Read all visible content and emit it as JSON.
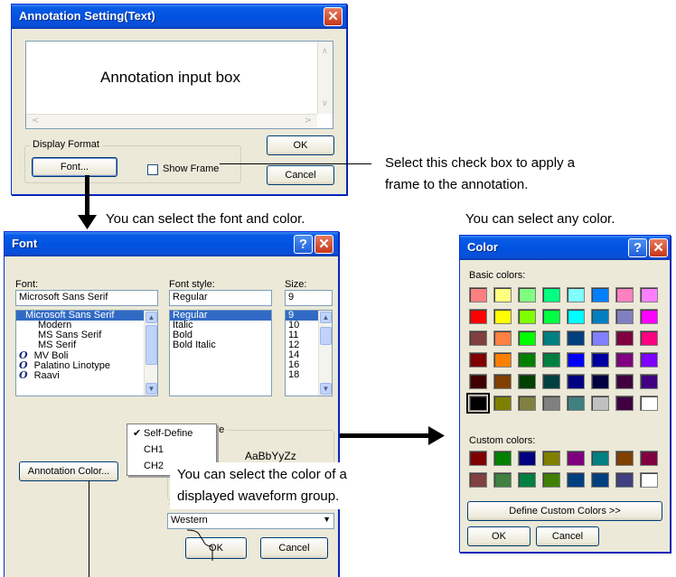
{
  "annotation_dialog": {
    "title": "Annotation Setting(Text)",
    "input_text": "Annotation input box",
    "group_label": "Display Format",
    "font_button": "Font...",
    "show_frame_label": "Show Frame",
    "ok_button": "OK",
    "cancel_button": "Cancel"
  },
  "font_dialog": {
    "title": "Font",
    "font_label": "Font:",
    "font_value": "Microsoft Sans Serif",
    "fonts": [
      "Microsoft Sans Serif",
      "Modern",
      "MS Sans Serif",
      "MS Serif",
      "MV Boli",
      "Palatino Linotype",
      "Raavi"
    ],
    "style_label": "Font style:",
    "style_value": "Regular",
    "styles": [
      "Regular",
      "Italic",
      "Bold",
      "Bold Italic"
    ],
    "size_label": "Size:",
    "size_value": "9",
    "sizes": [
      "9",
      "10",
      "11",
      "12",
      "14",
      "16",
      "18"
    ],
    "sample_label": "Sample",
    "sample_text": "AaBbYyZz",
    "annotation_color_button": "Annotation Color...",
    "script_label_fragment": "S",
    "script_value": "Western",
    "ok_button": "OK",
    "cancel_button": "Cancel"
  },
  "color_menu": {
    "items": [
      "Self-Define",
      "CH1",
      "CH2"
    ],
    "checked_index": 0
  },
  "color_dialog": {
    "title": "Color",
    "basic_label": "Basic colors:",
    "custom_label": "Custom colors:",
    "define_button": "Define Custom Colors >>",
    "ok_button": "OK",
    "cancel_button": "Cancel",
    "basic_colors": [
      "#ff8080",
      "#ffff80",
      "#80ff80",
      "#00ff80",
      "#80ffff",
      "#0080ff",
      "#ff80c0",
      "#ff80ff",
      "#ff0000",
      "#ffff00",
      "#80ff00",
      "#00ff40",
      "#00ffff",
      "#0080c0",
      "#8080c0",
      "#ff00ff",
      "#804040",
      "#ff8040",
      "#00ff00",
      "#008080",
      "#004080",
      "#8080ff",
      "#800040",
      "#ff0080",
      "#800000",
      "#ff8000",
      "#008000",
      "#008040",
      "#0000ff",
      "#0000a0",
      "#800080",
      "#8000ff",
      "#400000",
      "#804000",
      "#004000",
      "#004040",
      "#000080",
      "#000040",
      "#400040",
      "#400080",
      "#000000",
      "#808000",
      "#808040",
      "#808080",
      "#408080",
      "#c0c0c0",
      "#400040",
      "#ffffff"
    ],
    "selected_basic_index": 40,
    "custom_colors": [
      "#800000",
      "#008000",
      "#000080",
      "#808000",
      "#800080",
      "#008080",
      "#804000",
      "#800040",
      "#804040",
      "#408040",
      "#008040",
      "#408000",
      "#004080",
      "#004080",
      "#404080",
      "#ffffff"
    ]
  },
  "annotations": {
    "show_frame_note_line1": "Select this check box to apply a",
    "show_frame_note_line2": "frame to the annotation.",
    "font_note": "You can select the font and color.",
    "any_color_note": "You can select any color.",
    "waveform_note_line1": "You can select the color of a",
    "waveform_note_line2": "displayed waveform group."
  }
}
